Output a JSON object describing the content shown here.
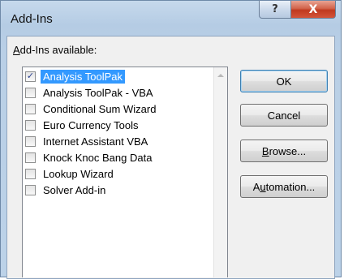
{
  "window": {
    "title": "Add-Ins",
    "help_glyph": "?",
    "close_glyph": "X"
  },
  "list": {
    "label_prefix": "",
    "label_accel": "A",
    "label_rest": "dd-Ins available:",
    "items": [
      {
        "label": "Analysis ToolPak",
        "checked": true,
        "selected": true
      },
      {
        "label": "Analysis ToolPak - VBA",
        "checked": false,
        "selected": false
      },
      {
        "label": "Conditional Sum Wizard",
        "checked": false,
        "selected": false
      },
      {
        "label": "Euro Currency Tools",
        "checked": false,
        "selected": false
      },
      {
        "label": "Internet Assistant VBA",
        "checked": false,
        "selected": false
      },
      {
        "label": "Knock Knoc Bang Data",
        "checked": false,
        "selected": false
      },
      {
        "label": "Lookup Wizard",
        "checked": false,
        "selected": false
      },
      {
        "label": "Solver Add-in",
        "checked": false,
        "selected": false
      }
    ],
    "check_glyph": "✓"
  },
  "buttons": {
    "ok": "OK",
    "cancel": "Cancel",
    "browse_accel": "B",
    "browse_rest": "rowse...",
    "automation_prefix": "A",
    "automation_accel": "u",
    "automation_rest": "tomation..."
  }
}
